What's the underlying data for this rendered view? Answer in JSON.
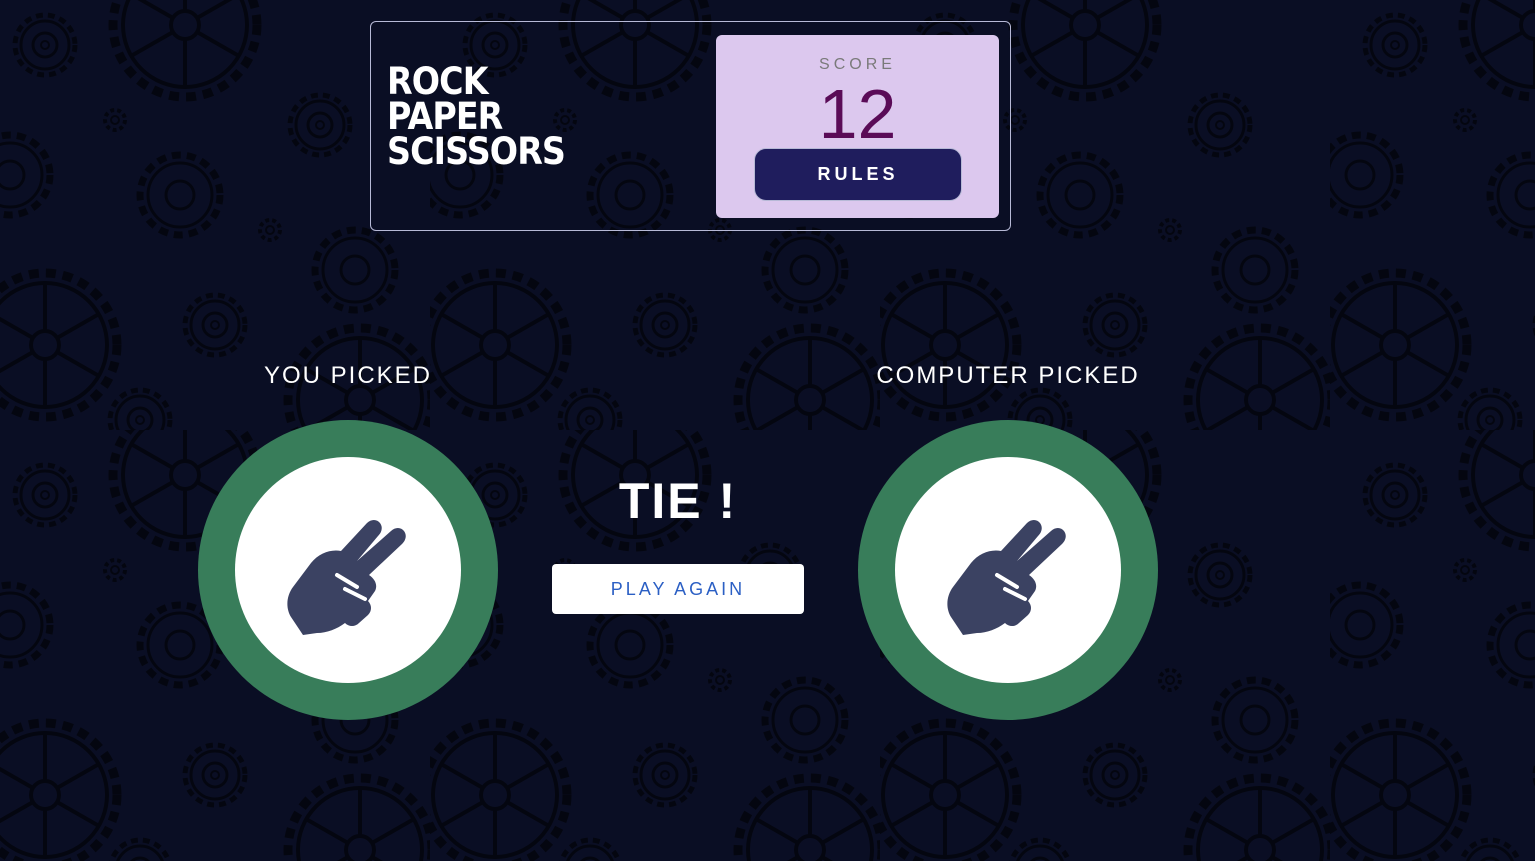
{
  "header": {
    "title_lines": [
      "ROCK",
      "PAPER",
      "SCISSORS"
    ],
    "score_label": "SCORE",
    "score_value": "12",
    "rules_label": "RULES"
  },
  "game": {
    "you_picked_label": "YOU PICKED",
    "computer_picked_label": "COMPUTER PICKED",
    "you_choice": "scissors",
    "computer_choice": "scissors",
    "result_text": "TIE !",
    "play_again_label": "PLAY AGAIN"
  },
  "colors": {
    "background": "#0a0e24",
    "score_box": "#dcc8ee",
    "score_value": "#5a0b57",
    "rules_button": "#1f1d5d",
    "token_ring": "#387d5a",
    "hand_icon": "#3b4262",
    "play_again_text": "#2b5fc4"
  },
  "icons": {
    "background_pattern": "gear-icon",
    "choice_icon": "scissors-hand-icon"
  }
}
